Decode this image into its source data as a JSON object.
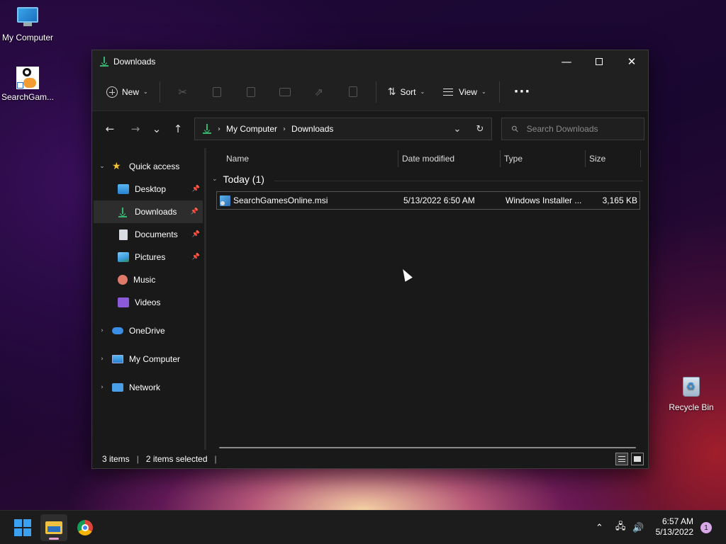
{
  "desktop": {
    "icons": [
      {
        "label": "My Computer",
        "icon": "monitor-icon"
      },
      {
        "label": "SearchGam...",
        "icon": "searchgames-installer-icon"
      },
      {
        "label": "Recycle Bin",
        "icon": "recycle-bin-icon"
      }
    ]
  },
  "window": {
    "title": "Downloads",
    "controls": {
      "minimize": "—",
      "maximize": "",
      "close": "✕"
    }
  },
  "toolbar": {
    "new_label": "New",
    "sort_label": "Sort",
    "view_label": "View",
    "more_label": "···",
    "icons": [
      "cut-icon",
      "copy-icon",
      "paste-icon",
      "rename-icon",
      "share-icon",
      "delete-icon"
    ]
  },
  "navigation": {
    "back": "←",
    "forward": "→",
    "recent": "⌄",
    "up": "↑",
    "breadcrumb": [
      "My Computer",
      "Downloads"
    ],
    "search_placeholder": "Search Downloads"
  },
  "sidebar": {
    "items": [
      {
        "label": "Quick access",
        "icon": "star-icon",
        "expanded": true
      },
      {
        "label": "Desktop",
        "icon": "desktop-icon",
        "pinned": true
      },
      {
        "label": "Downloads",
        "icon": "downloads-icon",
        "pinned": true,
        "selected": true
      },
      {
        "label": "Documents",
        "icon": "documents-icon",
        "pinned": true
      },
      {
        "label": "Pictures",
        "icon": "pictures-icon",
        "pinned": true
      },
      {
        "label": "Music",
        "icon": "music-icon"
      },
      {
        "label": "Videos",
        "icon": "videos-icon"
      },
      {
        "label": "OneDrive",
        "icon": "onedrive-icon",
        "expanded": false
      },
      {
        "label": "My Computer",
        "icon": "computer-icon",
        "expanded": false
      },
      {
        "label": "Network",
        "icon": "network-icon",
        "expanded": false
      }
    ]
  },
  "file_list": {
    "columns": [
      "Name",
      "Date modified",
      "Type",
      "Size"
    ],
    "group": "Today (1)",
    "rows": [
      {
        "name": "SearchGamesOnline.msi",
        "date": "5/13/2022 6:50 AM",
        "type": "Windows Installer ...",
        "size": "3,165 KB"
      }
    ]
  },
  "status": {
    "items": "3 items",
    "selected": "2 items selected"
  },
  "taskbar": {
    "time": "6:57 AM",
    "date": "5/13/2022",
    "notifications": "1"
  },
  "colors": {
    "accent_green": "#37b46e",
    "window_bg": "#191919",
    "taskbar_bg": "#1c1c1c"
  }
}
